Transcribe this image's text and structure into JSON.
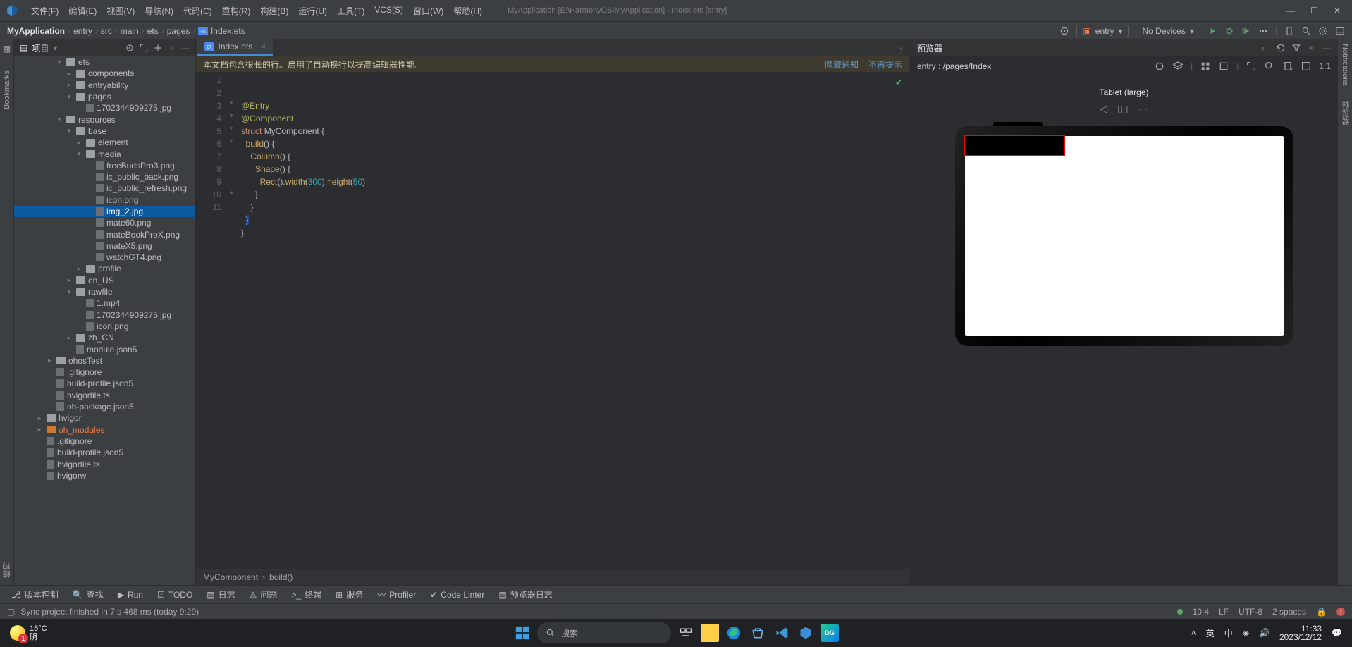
{
  "window": {
    "title": "MyApplication [E:\\HarmonyOS\\MyApplication] - Index.ets [entry]"
  },
  "menu": [
    "文件(F)",
    "编辑(E)",
    "视图(V)",
    "导航(N)",
    "代码(C)",
    "重构(R)",
    "构建(B)",
    "运行(U)",
    "工具(T)",
    "VCS(S)",
    "窗口(W)",
    "帮助(H)"
  ],
  "breadcrumbs": [
    "MyApplication",
    "entry",
    "src",
    "main",
    "ets",
    "pages",
    "Index.ets"
  ],
  "runbox": {
    "entry": "entry",
    "devices": "No Devices"
  },
  "project": {
    "title": "项目",
    "tree": [
      {
        "d": 0,
        "a": "▾",
        "ic": "f",
        "t": "ets"
      },
      {
        "d": 1,
        "a": "▸",
        "ic": "f",
        "t": "components"
      },
      {
        "d": 1,
        "a": "▸",
        "ic": "f",
        "t": "entryability"
      },
      {
        "d": 1,
        "a": "▾",
        "ic": "f",
        "t": "pages"
      },
      {
        "d": 2,
        "a": "",
        "ic": "p",
        "t": "1702344909275.jpg"
      },
      {
        "d": 0,
        "a": "▾",
        "ic": "f",
        "t": "resources"
      },
      {
        "d": 1,
        "a": "▾",
        "ic": "f",
        "t": "base"
      },
      {
        "d": 2,
        "a": "▸",
        "ic": "f",
        "t": "element"
      },
      {
        "d": 2,
        "a": "▾",
        "ic": "f",
        "t": "media"
      },
      {
        "d": 3,
        "a": "",
        "ic": "p",
        "t": "freeBudsPro3.png"
      },
      {
        "d": 3,
        "a": "",
        "ic": "p",
        "t": "ic_public_back.png"
      },
      {
        "d": 3,
        "a": "",
        "ic": "p",
        "t": "ic_public_refresh.png"
      },
      {
        "d": 3,
        "a": "",
        "ic": "p",
        "t": "icon.png"
      },
      {
        "d": 3,
        "a": "",
        "ic": "p",
        "t": "img_2.jpg",
        "sel": true
      },
      {
        "d": 3,
        "a": "",
        "ic": "p",
        "t": "mate60.png"
      },
      {
        "d": 3,
        "a": "",
        "ic": "p",
        "t": "mateBookProX.png"
      },
      {
        "d": 3,
        "a": "",
        "ic": "p",
        "t": "mateX5.png"
      },
      {
        "d": 3,
        "a": "",
        "ic": "p",
        "t": "watchGT4.png"
      },
      {
        "d": 2,
        "a": "▸",
        "ic": "f",
        "t": "profile"
      },
      {
        "d": 1,
        "a": "▸",
        "ic": "f",
        "t": "en_US"
      },
      {
        "d": 1,
        "a": "▾",
        "ic": "f",
        "t": "rawfile"
      },
      {
        "d": 2,
        "a": "",
        "ic": "p",
        "t": "1.mp4"
      },
      {
        "d": 2,
        "a": "",
        "ic": "p",
        "t": "1702344909275.jpg"
      },
      {
        "d": 2,
        "a": "",
        "ic": "p",
        "t": "icon.png"
      },
      {
        "d": 1,
        "a": "▸",
        "ic": "f",
        "t": "zh_CN"
      },
      {
        "d": 1,
        "a": "",
        "ic": "p",
        "t": "module.json5"
      },
      {
        "d": -1,
        "a": "▸",
        "ic": "f",
        "t": "ohosTest"
      },
      {
        "d": -1,
        "a": "",
        "ic": "p",
        "t": ".gitignore"
      },
      {
        "d": -1,
        "a": "",
        "ic": "p",
        "t": "build-profile.json5"
      },
      {
        "d": -1,
        "a": "",
        "ic": "p",
        "t": "hvigorfile.ts"
      },
      {
        "d": -1,
        "a": "",
        "ic": "p",
        "t": "oh-package.json5"
      },
      {
        "d": -2,
        "a": "▸",
        "ic": "f",
        "t": "hvigor"
      },
      {
        "d": -2,
        "a": "▸",
        "ic": "fo",
        "t": "oh_modules",
        "orng": true
      },
      {
        "d": -2,
        "a": "",
        "ic": "p",
        "t": ".gitignore"
      },
      {
        "d": -2,
        "a": "",
        "ic": "p",
        "t": "build-profile.json5"
      },
      {
        "d": -2,
        "a": "",
        "ic": "p",
        "t": "hvigorfile.ts"
      },
      {
        "d": -2,
        "a": "",
        "ic": "p",
        "t": "hvigorw"
      }
    ]
  },
  "editor": {
    "tab": "Index.ets",
    "banner": "本文档包含很长的行。启用了自动换行以提高编辑器性能。",
    "banner_links": [
      "隐藏通知",
      "不再提示"
    ],
    "lines": [
      "1",
      "2",
      "3",
      "4",
      "5",
      "6",
      "7",
      "8",
      "9",
      "10",
      "11"
    ],
    "code_crumbs": [
      "MyComponent",
      "build()"
    ]
  },
  "preview": {
    "title": "预览器",
    "path": "entry : /pages/Index",
    "device": "Tablet (large)"
  },
  "bottom_tools": [
    "版本控制",
    "查找",
    "Run",
    "TODO",
    "日志",
    "问题",
    "终端",
    "服务",
    "Profiler",
    "Code Linter",
    "预览器日志"
  ],
  "status": {
    "msg": "Sync project finished in 7 s 468 ms (today 9:29)",
    "right": [
      "10:4",
      "LF",
      "UTF-8",
      "2 spaces"
    ]
  },
  "taskbar": {
    "temp": "15°C",
    "cond": "阴",
    "search": "搜索",
    "tray_lang": "英",
    "tray_ime": "中",
    "time": "11:33",
    "date": "2023/12/12"
  }
}
